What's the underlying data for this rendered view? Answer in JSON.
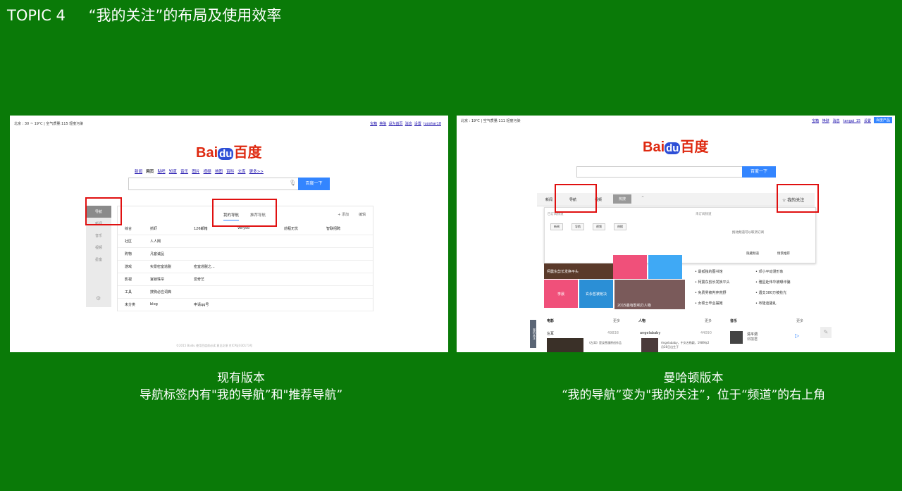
{
  "slide": {
    "topic": "TOPIC 4",
    "title": "“我的关注”的布局及使用效率"
  },
  "left": {
    "caption_line1": "现有版本",
    "caption_line2": "导航标签内有\"我的导航”和\"推荐导航”",
    "topbar_left": "北京 : 30 ~ 19℃  |  空气质量:115  轻度污染",
    "topbar_right": [
      "宝箱",
      "换肤",
      "设为首页",
      "消息",
      "设置",
      "luoshar18"
    ],
    "logo": {
      "bai": "Bai",
      "du": "du",
      "cn": "百度"
    },
    "nav_links": [
      "新闻",
      "网页",
      "贴吧",
      "知道",
      "音乐",
      "图片",
      "视频",
      "地图",
      "百科",
      "文库",
      "更多>>"
    ],
    "search_button": "百度一下",
    "side_nav": [
      "导航",
      "新闻",
      "音乐",
      "视频",
      "星座"
    ],
    "tabs": {
      "mine": "我的导航",
      "recommend": "推荐导航",
      "add": "+ 添加",
      "edit": "编辑"
    },
    "rows": [
      {
        "cat": "综合",
        "items": [
          "抓虾",
          "126邮箱",
          "Veryoo",
          "前程无忧",
          "智联招聘"
        ]
      },
      {
        "cat": "社区",
        "items": [
          "人人网"
        ]
      },
      {
        "cat": "购物",
        "items": [
          "凡客诚品"
        ]
      },
      {
        "cat": "游戏",
        "items": [
          "实景密室逃脱",
          "密室逃脱之..."
        ]
      },
      {
        "cat": "影视",
        "items": [
          "宫锁珠帘",
          "爱奇艺"
        ]
      },
      {
        "cat": "工具",
        "items": [
          "搜狗必应词典"
        ]
      },
      {
        "cat": "未分类",
        "items": [
          "blog",
          "申请qq号"
        ]
      }
    ],
    "footer": "©2015 Baidu 使用百度前必读 意见反馈 京ICP证030173号"
  },
  "right": {
    "caption_line1": "曼哈顿版本",
    "caption_line2": "“我的导航”变为\"我的关注”，位于“频道”的右上角",
    "topbar_left": "北京 :  19℃  |  空气质量:111  轻度污染",
    "topbar_right": [
      "宝箱",
      "换肤",
      "消息",
      "tangqi_15",
      "设置",
      "百度产品"
    ],
    "logo": {
      "bai": "Bai",
      "du": "du",
      "cn": "百度"
    },
    "search_button": "百度一下",
    "channel_tabs": [
      "新闻",
      "导航",
      "视频",
      "热搜"
    ],
    "my_follow": "☆ 我的关注",
    "subscribed_label": "已订阅频道",
    "unsubscribed_label": "未订阅频道",
    "pills": [
      "新闻",
      "导航",
      "视频",
      "热搜"
    ],
    "drag_hint": "拖动频道可以取消订阅",
    "hide_channel": "隐藏频道",
    "smart_recommend": "情景推荐",
    "tiles": [
      "柯震东剪长发换平头",
      "李晨",
      "玄永哲被枪决",
      "2015最有影响力人物"
    ],
    "headlines_left": [
      "最孤独的图书馆",
      "柯震东剪长发换平头",
      "免费男被判弃荒野",
      "女硕士毕业摆摊"
    ],
    "headlines_right": [
      "邓小平动漫形象",
      "雅星赴伟华被曝诈骗",
      "遇支380万被抢光",
      "布隆迪骚乱"
    ],
    "sections": [
      {
        "title": "电影",
        "more": "更多",
        "item": "左耳",
        "count": "49838"
      },
      {
        "title": "人物",
        "more": "更多",
        "item": "angelababy",
        "count": "44090"
      },
      {
        "title": "音乐",
        "more": "更多",
        "item": "清平调",
        "count": "邓丽君"
      }
    ],
    "movie_desc": "《左耳》是饶雪漫原创作品",
    "person_desc": "Angelababy，中文名杨颖，1989年2月28日出生于",
    "side_tab": "我的关注"
  }
}
